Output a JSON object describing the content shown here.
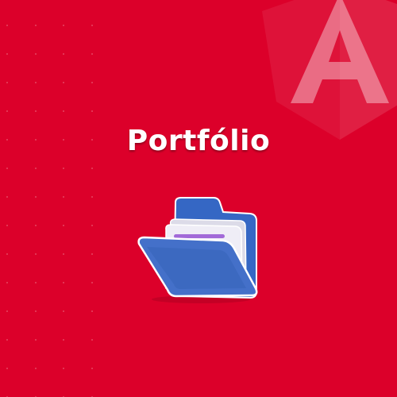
{
  "page": {
    "title": "Portfólio"
  },
  "icons": {
    "brand": "angular-logo-icon",
    "folder": "open-folder-icon"
  },
  "colors": {
    "background": "#dc002a",
    "logo": "#ffffff",
    "folder_blue": "#3f6fc6",
    "folder_blue_dark": "#2a4f98",
    "paper": "#eceaf2",
    "paper_lines": "#a26ad8",
    "title": "#ffffff"
  }
}
